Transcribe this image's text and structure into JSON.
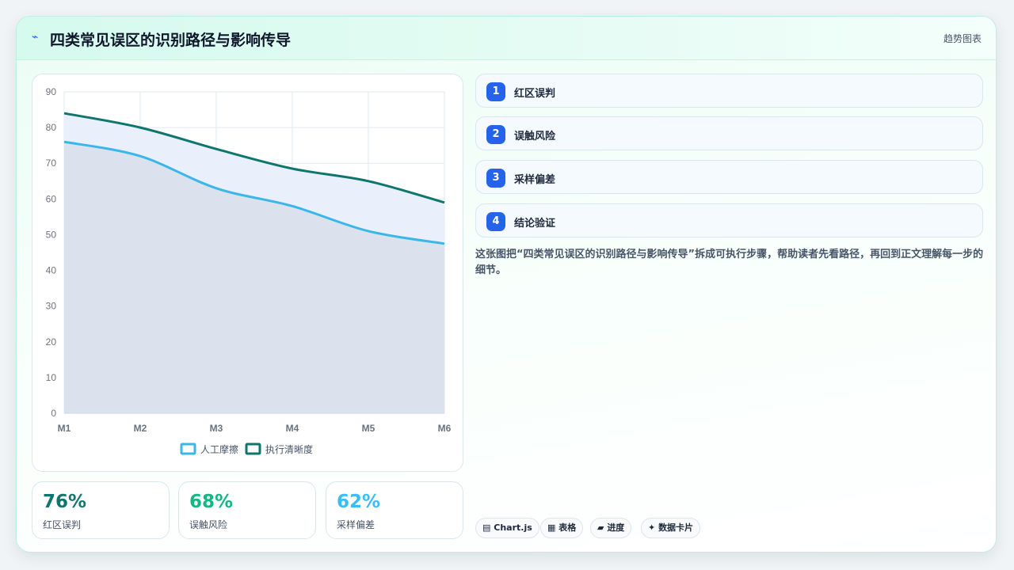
{
  "header": {
    "icon": "trend-line-icon",
    "title": "四类常见误区的识别路径与影响传导",
    "right_label": "趋势图表"
  },
  "chart_data": {
    "type": "area",
    "categories": [
      "M1",
      "M2",
      "M3",
      "M4",
      "M5",
      "M6"
    ],
    "ylim": [
      0,
      90
    ],
    "yticks": [
      0,
      10,
      20,
      30,
      40,
      50,
      60,
      70,
      80,
      90
    ],
    "grid": true,
    "legend_position": "bottom",
    "series": [
      {
        "name": "人工摩擦",
        "values": [
          76,
          72,
          63,
          58,
          51,
          47.5
        ],
        "color": "#3bb6e8",
        "fill": "#dbe2ee"
      },
      {
        "name": "执行清晰度",
        "values": [
          84,
          80,
          74,
          68.5,
          65,
          59
        ],
        "color": "#0f766e",
        "fill": "#e9f0fc"
      }
    ]
  },
  "stats": [
    {
      "value": "76%",
      "label": "红区误判",
      "color": "#0f766e"
    },
    {
      "value": "68%",
      "label": "误触风险",
      "color": "#10b981"
    },
    {
      "value": "62%",
      "label": "采样偏差",
      "color": "#38bdf8"
    }
  ],
  "steps": [
    {
      "num": "1",
      "label": "红区误判"
    },
    {
      "num": "2",
      "label": "误触风险"
    },
    {
      "num": "3",
      "label": "采样偏差"
    },
    {
      "num": "4",
      "label": "结论验证"
    }
  ],
  "description": "这张图把“四类常见误区的识别路径与影响传导”拆成可执行步骤，帮助读者先看路径，再回到正文理解每一步的细节。",
  "tags": [
    {
      "icon": "chart-icon",
      "glyph": "▤",
      "label": "Chart.js"
    },
    {
      "icon": "table-icon",
      "glyph": "▦",
      "label": "表格"
    },
    {
      "icon": "progress-icon",
      "glyph": "▰",
      "label": "进度"
    },
    {
      "icon": "data-card-icon",
      "glyph": "✦",
      "label": "数据卡片"
    }
  ]
}
